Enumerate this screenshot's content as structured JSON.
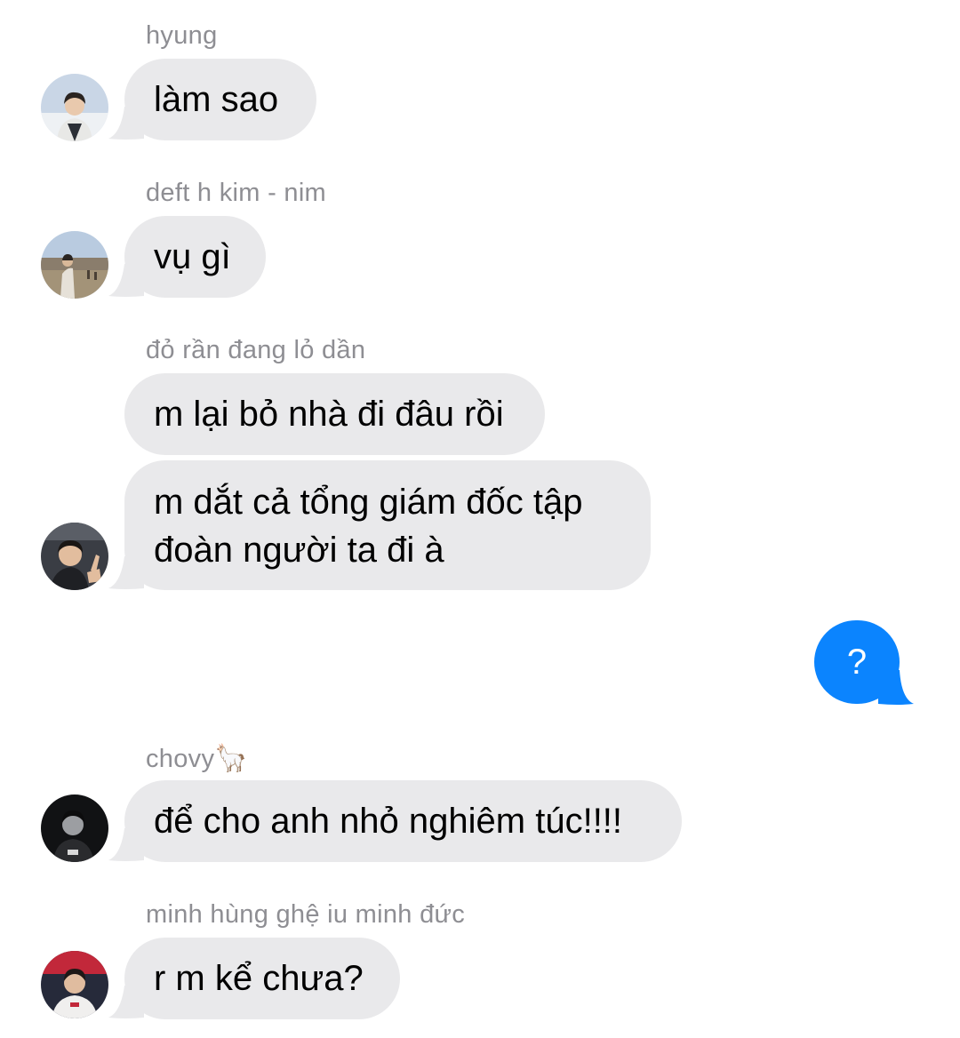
{
  "colors": {
    "incoming_bubble": "#e9e9eb",
    "outgoing_bubble": "#0b84fe",
    "sender_name": "#8e8e93",
    "incoming_text": "#000000",
    "outgoing_text": "#ffffff"
  },
  "messages": [
    {
      "direction": "incoming",
      "sender": "hyung",
      "text": "làm sao",
      "avatar": "avatar-hyung"
    },
    {
      "direction": "incoming",
      "sender": "deft h kim - nim",
      "text": "vụ gì",
      "avatar": "avatar-deft"
    },
    {
      "direction": "incoming",
      "sender": "đỏ rần đang lỏ dần",
      "text": "m lại bỏ nhà đi đâu rồi"
    },
    {
      "direction": "incoming",
      "text": "m dắt cả tổng giám đốc tập đoàn người ta đi à",
      "avatar": "avatar-do-ran"
    },
    {
      "direction": "outgoing",
      "text": "?"
    },
    {
      "direction": "incoming",
      "sender": "chovy",
      "sender_emoji": "🦙",
      "text": "để cho anh nhỏ nghiêm túc!!!!",
      "avatar": "avatar-chovy"
    },
    {
      "direction": "incoming",
      "sender": "minh hùng ghệ iu minh đức",
      "text": "r m kể chưa?",
      "avatar": "avatar-minh-hung"
    }
  ]
}
